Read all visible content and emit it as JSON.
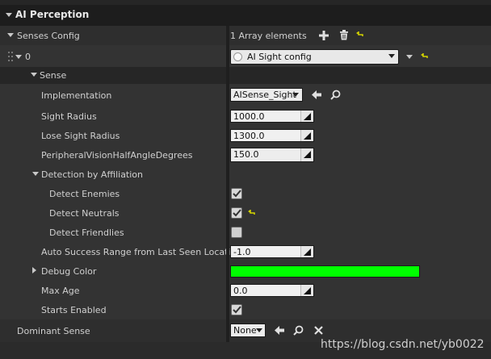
{
  "section": {
    "title": "AI Perception"
  },
  "senses_config": {
    "label": "Senses Config",
    "value": "1 Array elements"
  },
  "element": {
    "index": "0",
    "selected": "AI Sight config"
  },
  "sense": {
    "label": "Sense"
  },
  "implementation": {
    "label": "Implementation",
    "value": "AISense_Sight"
  },
  "sight_radius": {
    "label": "Sight Radius",
    "value": "1000.0"
  },
  "lose_sight_radius": {
    "label": "Lose Sight Radius",
    "value": "1300.0"
  },
  "peripheral": {
    "label": "PeripheralVisionHalfAngleDegrees",
    "value": "150.0"
  },
  "affiliation": {
    "label": "Detection by Affiliation"
  },
  "detect_enemies": {
    "label": "Detect Enemies",
    "checked": true
  },
  "detect_neutrals": {
    "label": "Detect Neutrals",
    "checked": true
  },
  "detect_friendlies": {
    "label": "Detect Friendlies",
    "checked": false
  },
  "auto_success": {
    "label": "Auto Success Range from Last Seen Location",
    "value": "-1.0"
  },
  "debug_color": {
    "label": "Debug Color",
    "color": "#00ff00"
  },
  "max_age": {
    "label": "Max Age",
    "value": "0.0"
  },
  "starts_enabled": {
    "label": "Starts Enabled",
    "checked": true
  },
  "dominant_sense": {
    "label": "Dominant Sense",
    "value": "None"
  },
  "watermark": "https://blog.csdn.net/yb0022"
}
